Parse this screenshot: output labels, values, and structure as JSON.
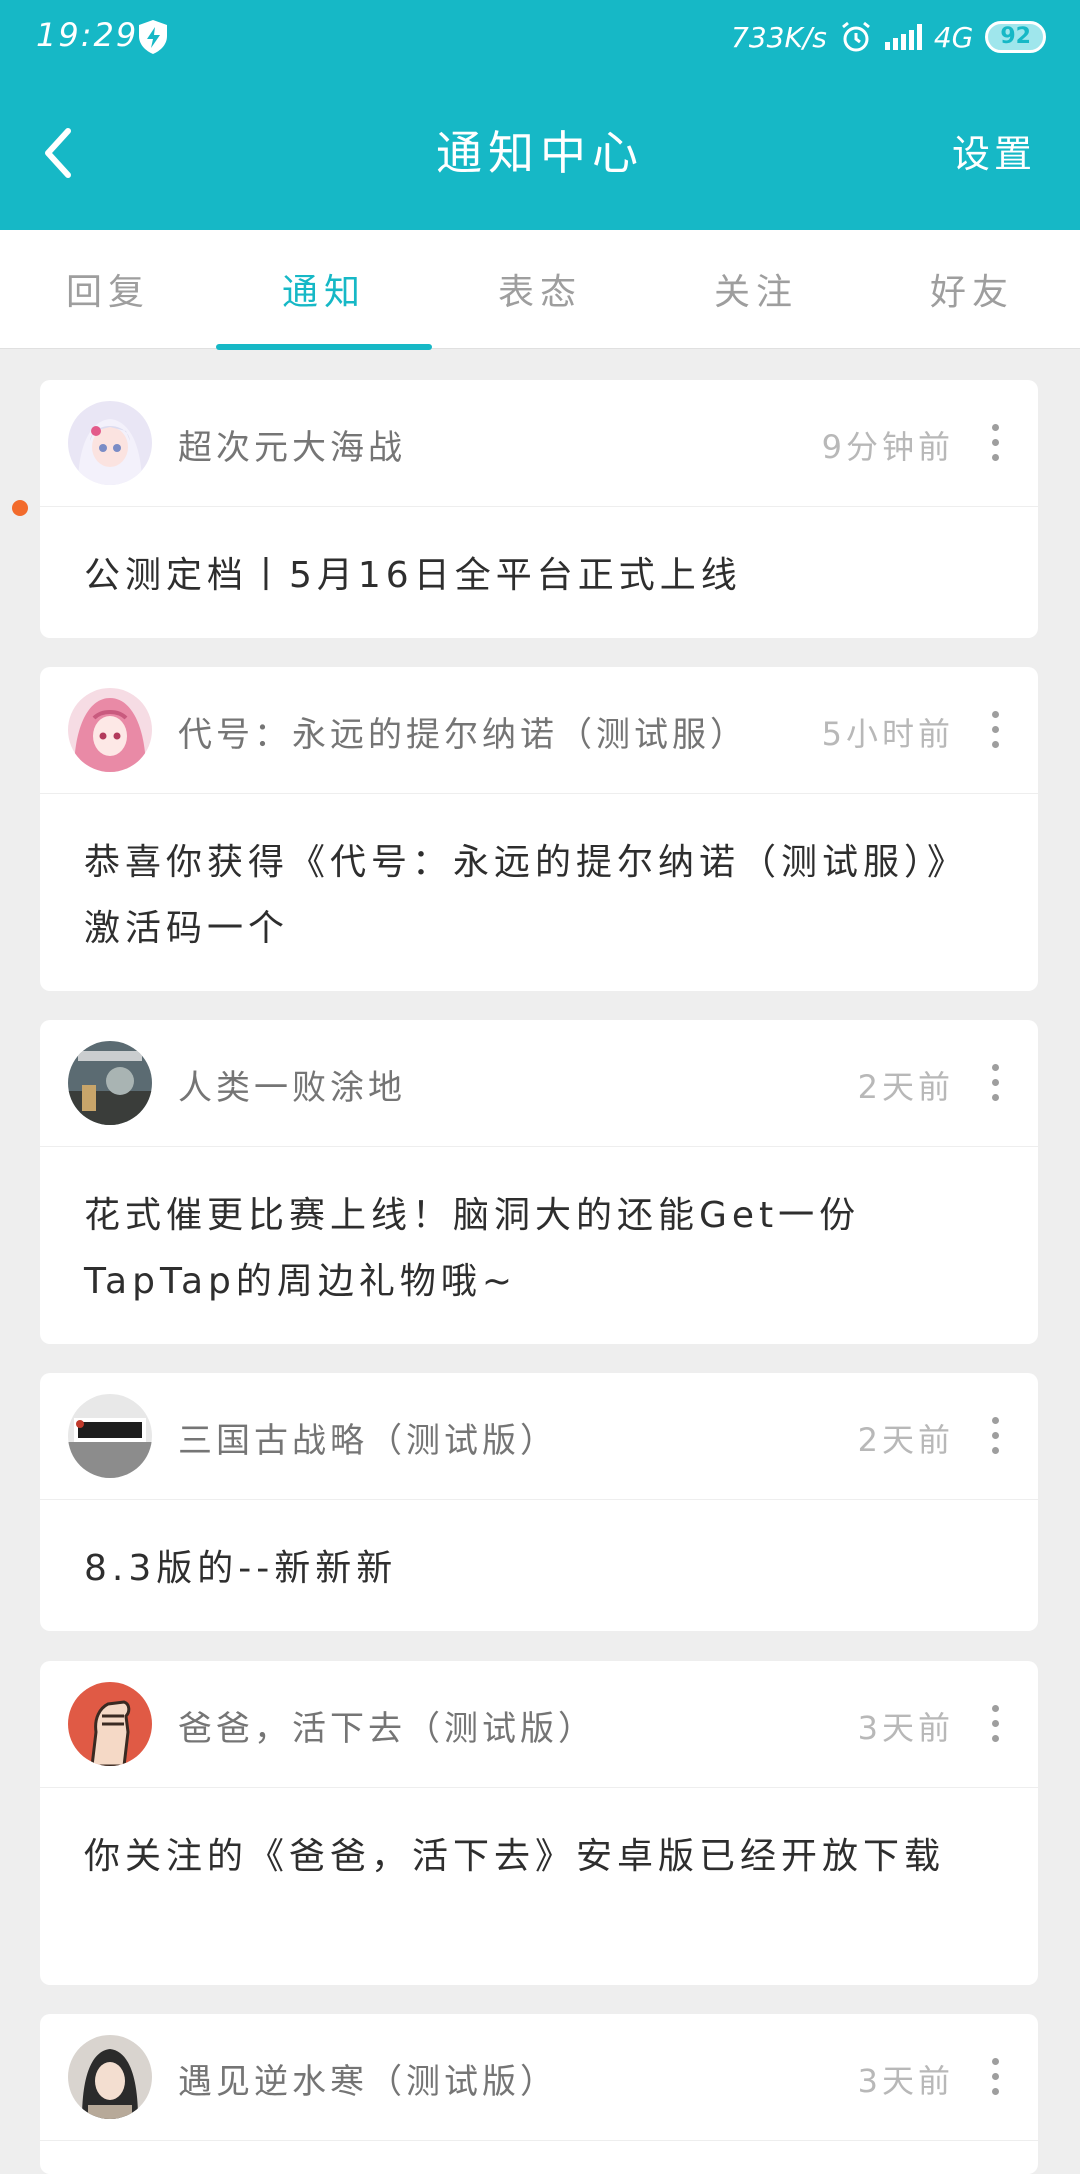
{
  "status_bar": {
    "time": "19:29",
    "speed": "733K/s",
    "network": "4G",
    "battery": "92"
  },
  "header": {
    "title": "通知中心",
    "settings_label": "设置"
  },
  "tabs": [
    {
      "label": "回复"
    },
    {
      "label": "通知"
    },
    {
      "label": "表态"
    },
    {
      "label": "关注"
    },
    {
      "label": "好友"
    }
  ],
  "active_tab": "通知",
  "colors": {
    "accent": "#16b8c6",
    "unread": "#f26b2c"
  },
  "notifications": [
    {
      "name": "超次元大海战",
      "time": "9分钟前",
      "body": "公测定档丨5月16日全平台正式上线",
      "unread": true
    },
    {
      "name": "代号：永远的提尔纳诺（测试服）",
      "time": "5小时前",
      "body": "恭喜你获得《代号：永远的提尔纳诺（测试服）》激活码一个"
    },
    {
      "name": "人类一败涂地",
      "time": "2天前",
      "body": "花式催更比赛上线！脑洞大的还能Get一份TapTap的周边礼物哦~"
    },
    {
      "name": "三国古战略（测试版）",
      "time": "2天前",
      "body": "8.3版的--新新新"
    },
    {
      "name": "爸爸，活下去（测试版）",
      "time": "3天前",
      "body": "你关注的《爸爸，活下去》安卓版已经开放下载"
    },
    {
      "name": "遇见逆水寒（测试版）",
      "time": "3天前",
      "body": ""
    }
  ]
}
